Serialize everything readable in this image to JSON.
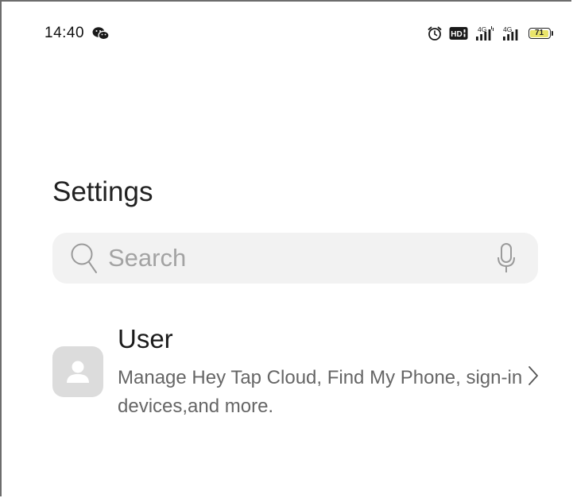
{
  "status_bar": {
    "time": "14:40",
    "notification_icon": "wechat-icon",
    "icons": [
      "alarm-icon",
      "hd-icon",
      "signal-4g-icon",
      "signal-4g-icon"
    ],
    "signal_labels": [
      "4G",
      "4G"
    ],
    "hd_label": "HD",
    "battery_level": "71"
  },
  "page": {
    "title": "Settings"
  },
  "search": {
    "placeholder": "Search",
    "value": "",
    "left_icon": "search-icon",
    "right_icon": "microphone-icon"
  },
  "user_section": {
    "title": "User",
    "description": "Manage Hey Tap Cloud, Find My Phone, sign-in devices,and more.",
    "avatar_icon": "person-icon",
    "arrow_icon": "chevron-right-icon"
  },
  "colors": {
    "search_bg": "#f2f2f2",
    "avatar_bg": "#dcdcdc",
    "battery_fill": "#e9e46a",
    "placeholder": "#a3a3a3",
    "secondary_text": "#666666"
  }
}
